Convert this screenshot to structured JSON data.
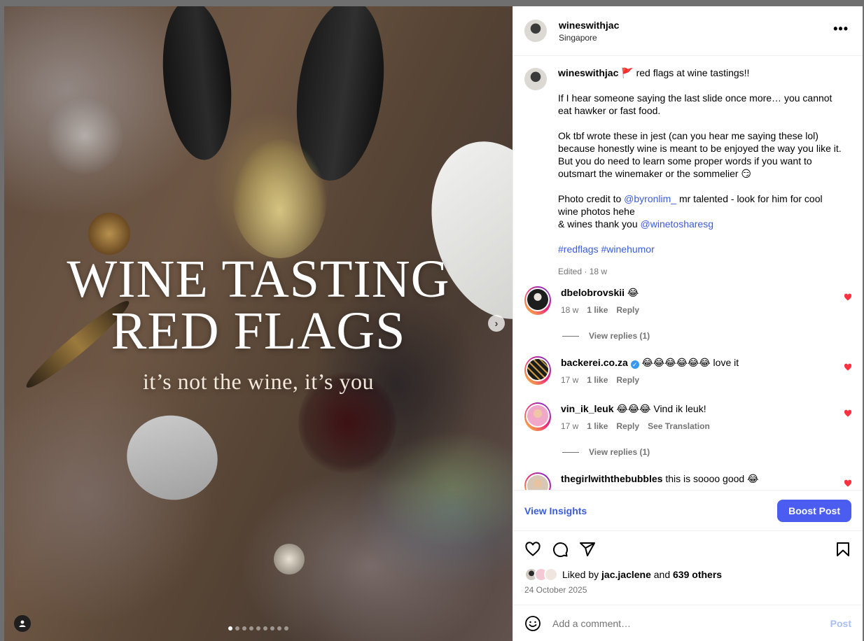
{
  "post": {
    "image": {
      "title_line1": "WINE TASTING",
      "title_line2": "RED FLAGS",
      "subtitle": "it’s not the wine, it’s you",
      "slide_count": 9,
      "active_slide": 1
    }
  },
  "header": {
    "username": "wineswithjac",
    "location": "Singapore",
    "more_label": "•••"
  },
  "caption": {
    "username": "wineswithjac",
    "flag": "🚩",
    "line1": "red flags at wine tastings!!",
    "para2": "If I hear someone saying the last slide once more… you cannot eat hawker or fast food.",
    "para3": "Ok tbf wrote these in jest (can you hear me saying these lol) because honestly wine is meant to be enjoyed the way you like it. But you do need to learn some proper words if you want to outsmart the winemaker or the sommelier 😏",
    "credit_prefix": "Photo credit to",
    "credit_mention": "@byronlim_",
    "credit_suffix": "mr talented - look for him for cool wine photos hehe",
    "thanks_prefix": "& wines thank you",
    "thanks_mention": "@winetosharesg",
    "hashtag1": "#redflags",
    "hashtag2": "#winehumor",
    "meta": "Edited · 18 w"
  },
  "comments": [
    {
      "username": "dbelobrovskii",
      "text": "😂",
      "time": "18 w",
      "likes": "1 like",
      "reply": "Reply",
      "view_replies": "View replies (1)"
    },
    {
      "username": "backerei.co.za",
      "verified": true,
      "text": "😂😂😂😂😂😂 love it",
      "time": "17 w",
      "likes": "1 like",
      "reply": "Reply"
    },
    {
      "username": "vin_ik_leuk",
      "text": "😂😂😂 Vind ik leuk!",
      "time": "17 w",
      "likes": "1 like",
      "reply": "Reply",
      "translate": "See Translation",
      "view_replies": "View replies (1)"
    },
    {
      "username": "thegirlwiththebubbles",
      "text": "this is soooo good 😂"
    }
  ],
  "insights": {
    "view_label": "View Insights",
    "boost_label": "Boost Post"
  },
  "likes": {
    "prefix": "Liked by",
    "user": "jac.jaclene",
    "middle": "and",
    "others": "639 others",
    "date": "24 October 2025"
  },
  "add_comment": {
    "placeholder": "Add a comment…",
    "post_label": "Post"
  },
  "colors": {
    "accent": "#4a5df0",
    "link": "#3b5bdb",
    "heart": "#ff3040",
    "muted": "#737373"
  }
}
